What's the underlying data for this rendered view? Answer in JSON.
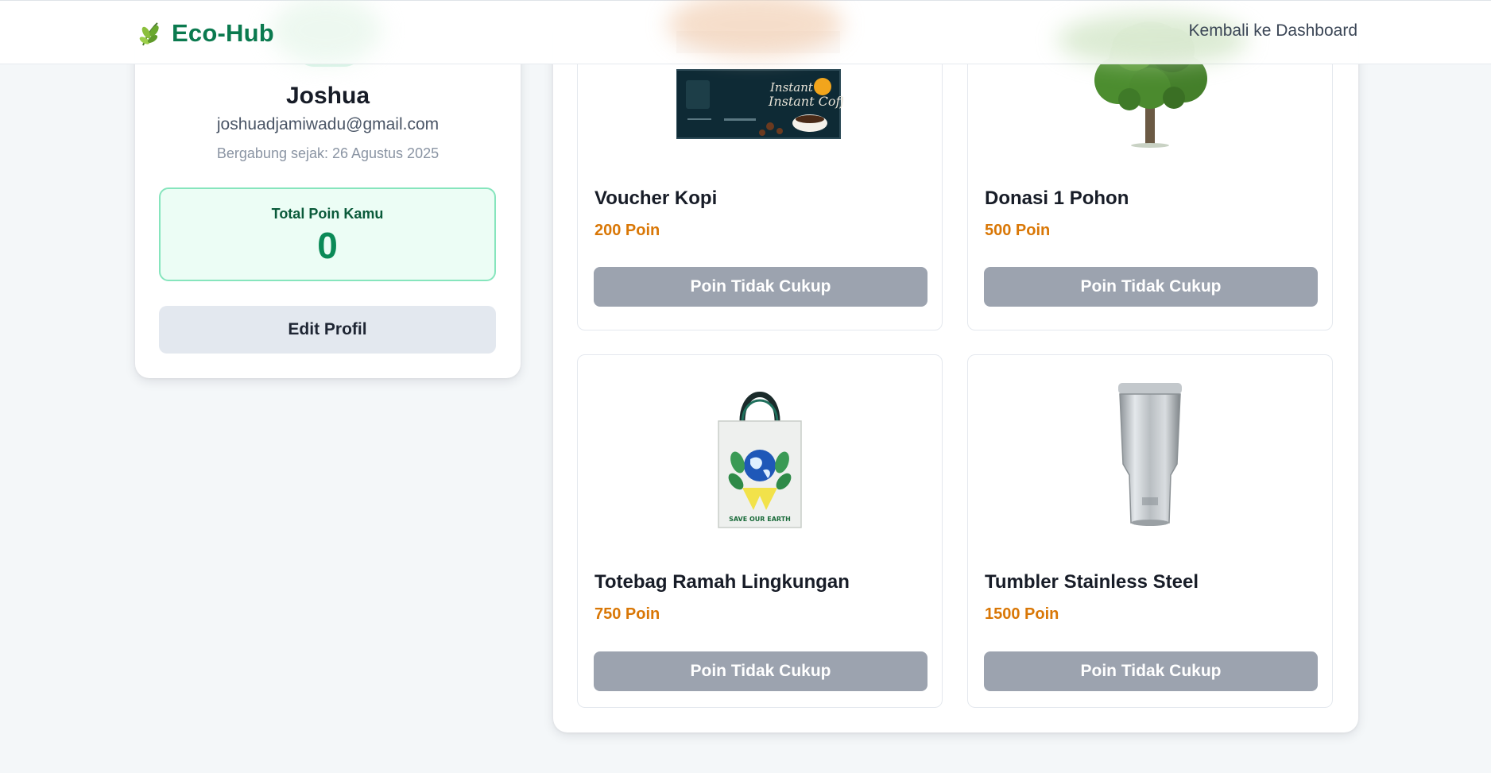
{
  "header": {
    "brand_name": "Eco-Hub",
    "brand_icon": "leaf-icon",
    "back_link": "Kembali ke Dashboard",
    "brand_color": "#0b7a4f"
  },
  "profile": {
    "name": "Joshua",
    "email": "joshuadjamiwadu@gmail.com",
    "joined": "Bergabung sejak: 26 Agustus 2025",
    "points_label": "Total Poin Kamu",
    "points_value": "0",
    "edit_button": "Edit Profil"
  },
  "rewards": {
    "items": [
      {
        "title": "Voucher Kopi",
        "cost": "200 Poin",
        "button": "Poin Tidak Cukup",
        "image": "coffee-voucher-image",
        "image_text": "Instant Coffee"
      },
      {
        "title": "Donasi 1 Pohon",
        "cost": "500 Poin",
        "button": "Poin Tidak Cukup",
        "image": "tree-image"
      },
      {
        "title": "Totebag Ramah Lingkungan",
        "cost": "750 Poin",
        "button": "Poin Tidak Cukup",
        "image": "totebag-image",
        "image_text": "SAVE OUR EARTH"
      },
      {
        "title": "Tumbler Stainless Steel",
        "cost": "1500 Poin",
        "button": "Poin Tidak Cukup",
        "image": "tumbler-image"
      }
    ]
  },
  "colors": {
    "accent_green": "#0b8a57",
    "cost_orange": "#d97706",
    "disabled_gray": "#9ca3af",
    "points_bg": "#ecfdf5"
  }
}
